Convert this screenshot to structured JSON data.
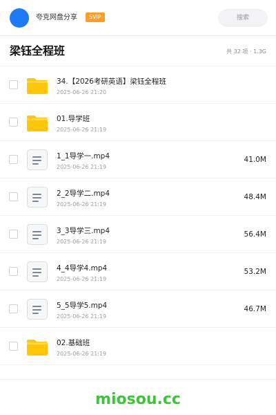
{
  "header": {
    "username": "夸克网盘分享",
    "badge": "SVIP",
    "search_placeholder": "搜索"
  },
  "folder": {
    "title": "梁钰全程班",
    "meta": "共 32 项 · 1.3G"
  },
  "colors": {
    "avatar": "#1e7bf5",
    "badge_bg": "#ff9d2a",
    "folder_icon": "#ffc60a",
    "watermark": "#3ec43a"
  },
  "files": [
    {
      "type": "folder",
      "icon": "folder-icon",
      "name": "34.【2026考研英语】梁钰全程班",
      "date": "2025-06-26 21:20",
      "size": ""
    },
    {
      "type": "folder",
      "icon": "folder-icon",
      "name": "01.导学班",
      "date": "2025-06-26 21:19",
      "size": ""
    },
    {
      "type": "file",
      "icon": "video-file-icon",
      "name": "1_1导学一.mp4",
      "date": "2025-06-26 21:19",
      "size": "41.0M"
    },
    {
      "type": "file",
      "icon": "video-file-icon",
      "name": "2_2导学二.mp4",
      "date": "2025-06-26 21:19",
      "size": "48.4M"
    },
    {
      "type": "file",
      "icon": "video-file-icon",
      "name": "3_3导学三.mp4",
      "date": "2025-06-26 21:19",
      "size": "56.4M"
    },
    {
      "type": "file",
      "icon": "video-file-icon",
      "name": "4_4导学4.mp4",
      "date": "2025-06-26 21:19",
      "size": "53.2M"
    },
    {
      "type": "file",
      "icon": "video-file-icon",
      "name": "5_5导学5.mp4",
      "date": "2025-06-26 21:19",
      "size": "46.7M"
    },
    {
      "type": "folder",
      "icon": "folder-icon",
      "name": "02.基础班",
      "date": "2025-06-26 21:19",
      "size": ""
    }
  ],
  "watermark": "miosou.cc"
}
